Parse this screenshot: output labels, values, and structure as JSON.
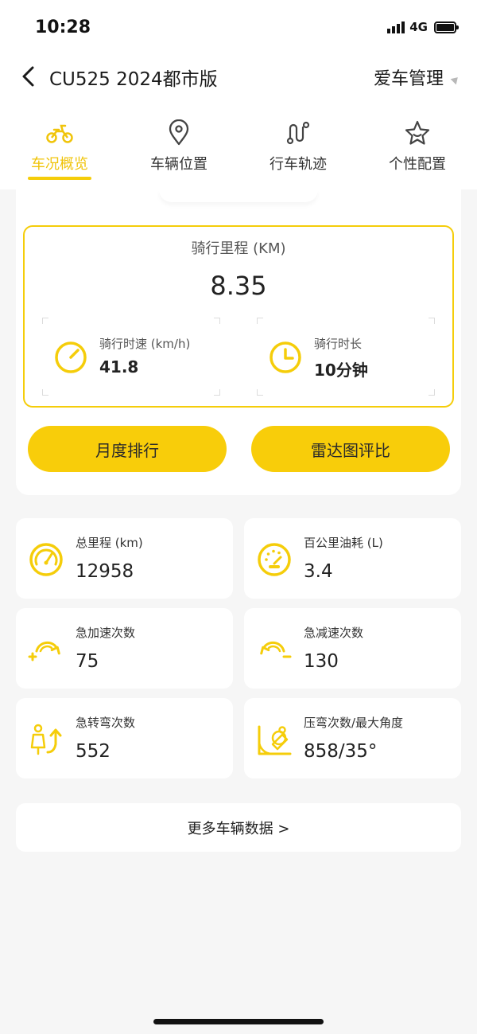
{
  "status_bar": {
    "time": "10:28",
    "network": "4G"
  },
  "header": {
    "title": "CU525 2024都市版",
    "manage_label": "爱车管理"
  },
  "tabs": [
    {
      "label": "车况概览",
      "icon": "scooter-icon",
      "active": true
    },
    {
      "label": "车辆位置",
      "icon": "location-pin-icon",
      "active": false
    },
    {
      "label": "行车轨迹",
      "icon": "route-icon",
      "active": false
    },
    {
      "label": "个性配置",
      "icon": "star-icon",
      "active": false
    }
  ],
  "ride": {
    "title": "骑行里程 (KM)",
    "value": "8.35",
    "speed": {
      "label": "骑行时速 (km/h)",
      "value": "41.8",
      "icon": "speed-gauge-icon"
    },
    "duration": {
      "label": "骑行时长",
      "value": "10分钟",
      "icon": "clock-icon"
    }
  },
  "buttons": {
    "monthly_rank": "月度排行",
    "radar_compare": "雷达图评比"
  },
  "stats": [
    {
      "label": "总里程 (km)",
      "value": "12958",
      "icon": "odometer-icon"
    },
    {
      "label": "百公里油耗 (L)",
      "value": "3.4",
      "icon": "fuel-gauge-icon"
    },
    {
      "label": "急加速次数",
      "value": "75",
      "icon": "rapid-acceleration-icon"
    },
    {
      "label": "急减速次数",
      "value": "130",
      "icon": "rapid-deceleration-icon"
    },
    {
      "label": "急转弯次数",
      "value": "552",
      "icon": "sharp-turn-icon"
    },
    {
      "label": "压弯次数/最大角度",
      "value": "858/35°",
      "icon": "lean-angle-icon"
    }
  ],
  "more_link": "更多车辆数据 >",
  "colors": {
    "accent": "#F8CD0A",
    "background": "#F6F6F6"
  }
}
